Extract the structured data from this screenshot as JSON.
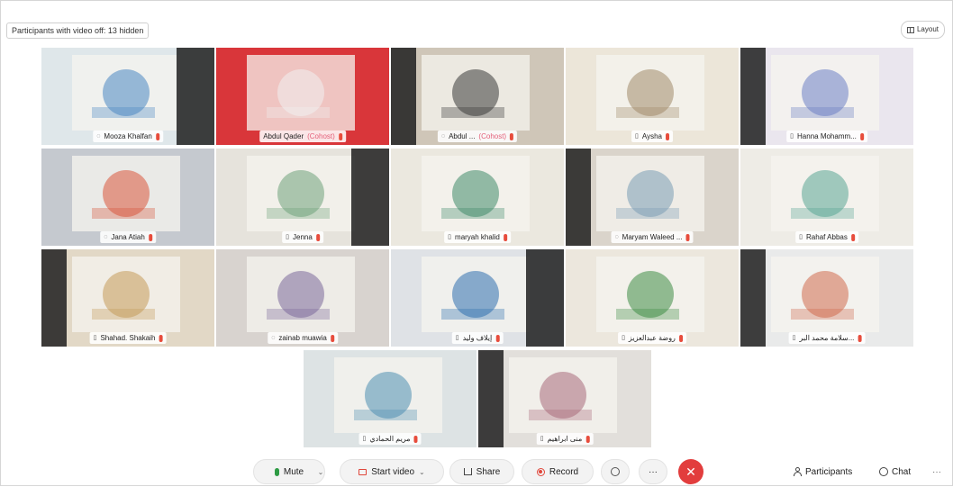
{
  "top_bar": {
    "hidden_label": "Participants with video off: 13 hidden",
    "layout_label": "Layout"
  },
  "participants": [
    {
      "name": "Mooza Khalfan",
      "suffix": "",
      "mode": "audio",
      "bg": "#dfe7ea",
      "accent": "#4b86c2"
    },
    {
      "name": "Abdul Qader",
      "suffix": "(Cohost)",
      "mode": "none",
      "bg": "#d9363a",
      "accent": "#f1f1f1"
    },
    {
      "name": "Abdul ...",
      "suffix": "(Cohost)",
      "mode": "audio",
      "bg": "#cfc6b8",
      "accent": "#3a3a3a"
    },
    {
      "name": "Aysha",
      "suffix": "",
      "mode": "phone",
      "bg": "#ece6d9",
      "accent": "#a08a6a"
    },
    {
      "name": "Hanna Mohamm...",
      "suffix": "",
      "mode": "phone",
      "bg": "#eae6ee",
      "accent": "#6b7fc4"
    },
    {
      "name": "Jana Atiah",
      "suffix": "",
      "mode": "audio",
      "bg": "#c5c9cf",
      "accent": "#d8553c"
    },
    {
      "name": "Jenna",
      "suffix": "",
      "mode": "phone",
      "bg": "#e6e3dc",
      "accent": "#6fa27a"
    },
    {
      "name": "maryah khalid",
      "suffix": "",
      "mode": "phone",
      "bg": "#ebe8df",
      "accent": "#3f8a6a"
    },
    {
      "name": "Maryam Waleed ...",
      "suffix": "",
      "mode": "audio",
      "bg": "#dad4cb",
      "accent": "#7a9fb4"
    },
    {
      "name": "Rahaf Abbas",
      "suffix": "",
      "mode": "phone",
      "bg": "#eeece6",
      "accent": "#5aa594"
    },
    {
      "name": "Shahad. Shakaih",
      "suffix": "",
      "mode": "phone",
      "bg": "#e2d8c6",
      "accent": "#c49a5a"
    },
    {
      "name": "zainab muawia",
      "suffix": "",
      "mode": "audio",
      "bg": "#d8d3cf",
      "accent": "#7c6a9a"
    },
    {
      "name": "إيلاف وليد",
      "suffix": "",
      "mode": "phone",
      "bg": "#dfe2e6",
      "accent": "#2f6fae"
    },
    {
      "name": "روضة عبدالعزيز",
      "suffix": "",
      "mode": "phone",
      "bg": "#ece7dd",
      "accent": "#3e8c46"
    },
    {
      "name": "سلامة محمد البر...",
      "suffix": "",
      "mode": "phone",
      "bg": "#e9eaea",
      "accent": "#cf6b4e"
    },
    {
      "name": "مريم الحمادي",
      "suffix": "",
      "mode": "phone",
      "bg": "#dde3e4",
      "accent": "#4f8fb2"
    },
    {
      "name": "منى ابراهيم",
      "suffix": "",
      "mode": "phone",
      "bg": "#e2dfdb",
      "accent": "#a86a7a"
    }
  ],
  "toolbar": {
    "mute_label": "Mute",
    "video_label": "Start video",
    "share_label": "Share",
    "record_label": "Record",
    "more_label": "···",
    "leave_label": "✕",
    "participants_label": "Participants",
    "chat_label": "Chat",
    "overflow_label": "···"
  },
  "colors": {
    "leave": "#e23d3d",
    "mic": "#2e9b44",
    "video_off": "#e0463a",
    "muted": "#e74c3c"
  }
}
